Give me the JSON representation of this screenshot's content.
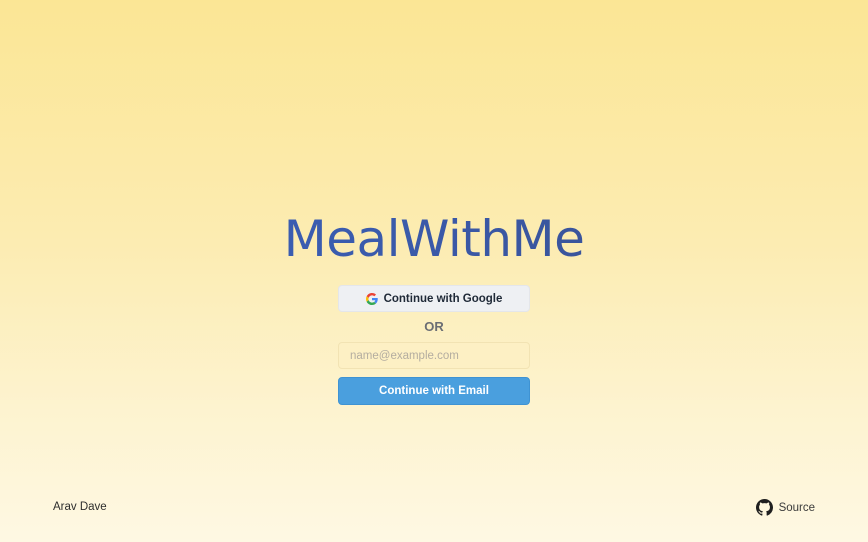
{
  "app": {
    "title": "MealWithMe"
  },
  "auth": {
    "google_button_label": "Continue with Google",
    "divider_text": "OR",
    "email_placeholder": "name@example.com",
    "email_value": "",
    "email_button_label": "Continue with Email"
  },
  "icons": {
    "google": "google-logo-icon",
    "source": "github-icon"
  },
  "footer": {
    "author": "Arav Dave",
    "source_label": "Source"
  },
  "colors": {
    "background_top": "#fbe695",
    "background_bottom": "#fef8e3",
    "title_gradient_start": "#3b64c2",
    "title_gradient_end": "#3a4c84",
    "email_button": "#4a9fde",
    "google_button": "#eef0f3"
  }
}
